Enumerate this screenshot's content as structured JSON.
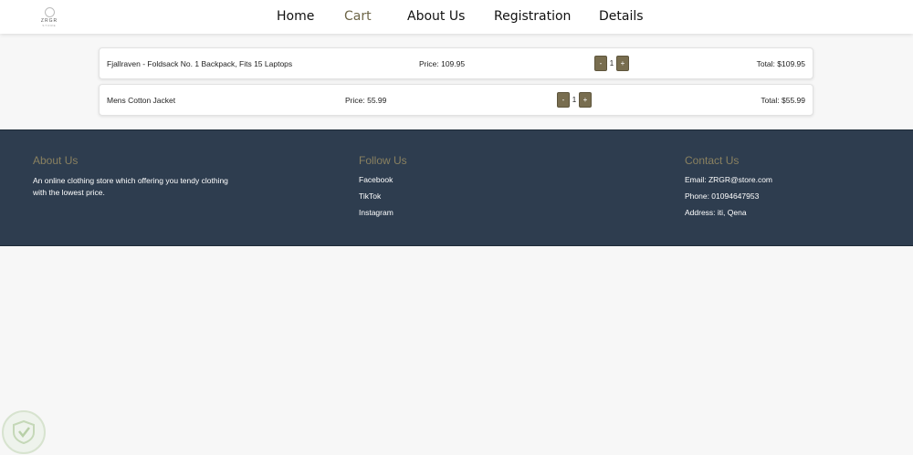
{
  "header": {
    "logo": {
      "brand": "ZRGR",
      "sub": "STORE"
    },
    "nav": [
      {
        "label": "Home",
        "active": false
      },
      {
        "label": "Cart",
        "active": true
      },
      {
        "label": "About Us",
        "active": false
      },
      {
        "label": "Registration",
        "active": false
      },
      {
        "label": "Details",
        "active": false
      }
    ]
  },
  "cart": {
    "items": [
      {
        "name": "Fjallraven - Foldsack No. 1 Backpack, Fits 15 Laptops",
        "price": "Price: 109.95",
        "decrement": "-",
        "quantity": "1",
        "increment": "+",
        "total": "Total: $109.95"
      },
      {
        "name": "Mens Cotton Jacket",
        "price": "Price: 55.99",
        "decrement": "-",
        "quantity": "1",
        "increment": "+",
        "total": "Total: $55.99"
      }
    ]
  },
  "footer": {
    "about": {
      "title": "About Us",
      "text": "An online clothing store which offering you tendy clothing with the lowest price."
    },
    "follow": {
      "title": "Follow Us",
      "links": [
        "Facebook",
        "TikTok",
        "Instagram"
      ]
    },
    "contact": {
      "title": "Contact Us",
      "email": "Email: ZRGR@store.com",
      "phone": "Phone: 01094647953",
      "address": "Address: iti, Qena"
    }
  },
  "colors": {
    "accent": "#786d4f",
    "footer_bg": "#2e3d4f",
    "footer_heading": "#8a8160",
    "page_bg": "#f7f7f7"
  }
}
